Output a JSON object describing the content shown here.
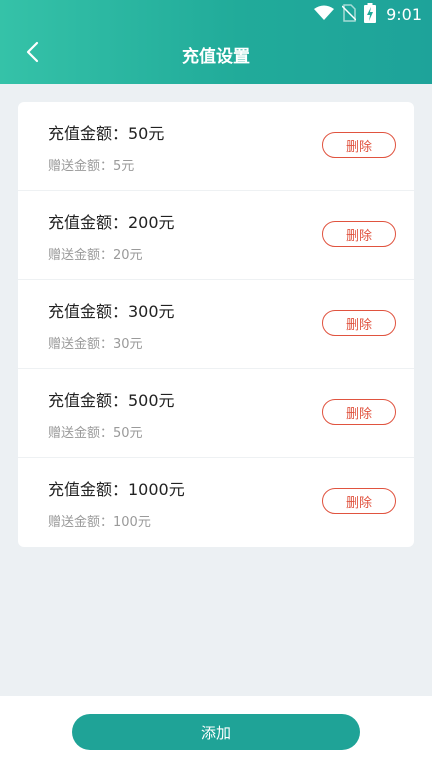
{
  "status_bar": {
    "time": "9:01",
    "icons": [
      "wifi-icon",
      "no-sim-icon",
      "battery-charging-icon"
    ]
  },
  "header": {
    "title": "充值设置",
    "back_icon": "chevron-left-icon"
  },
  "recharge_items": [
    {
      "amount": "充值金额：50元",
      "gift": "赠送金额：5元",
      "delete_label": "删除"
    },
    {
      "amount": "充值金额：200元",
      "gift": "赠送金额：20元",
      "delete_label": "删除"
    },
    {
      "amount": "充值金额：300元",
      "gift": "赠送金额：30元",
      "delete_label": "删除"
    },
    {
      "amount": "充值金额：500元",
      "gift": "赠送金额：50元",
      "delete_label": "删除"
    },
    {
      "amount": "充值金额：1000元",
      "gift": "赠送金额：100元",
      "delete_label": "删除"
    }
  ],
  "footer": {
    "add_label": "添加"
  },
  "colors": {
    "header_start": "#35c2a8",
    "header_end": "#1ea39a",
    "delete_red": "#e0533f",
    "add_button": "#1fa397",
    "background": "#ecf0f3"
  }
}
